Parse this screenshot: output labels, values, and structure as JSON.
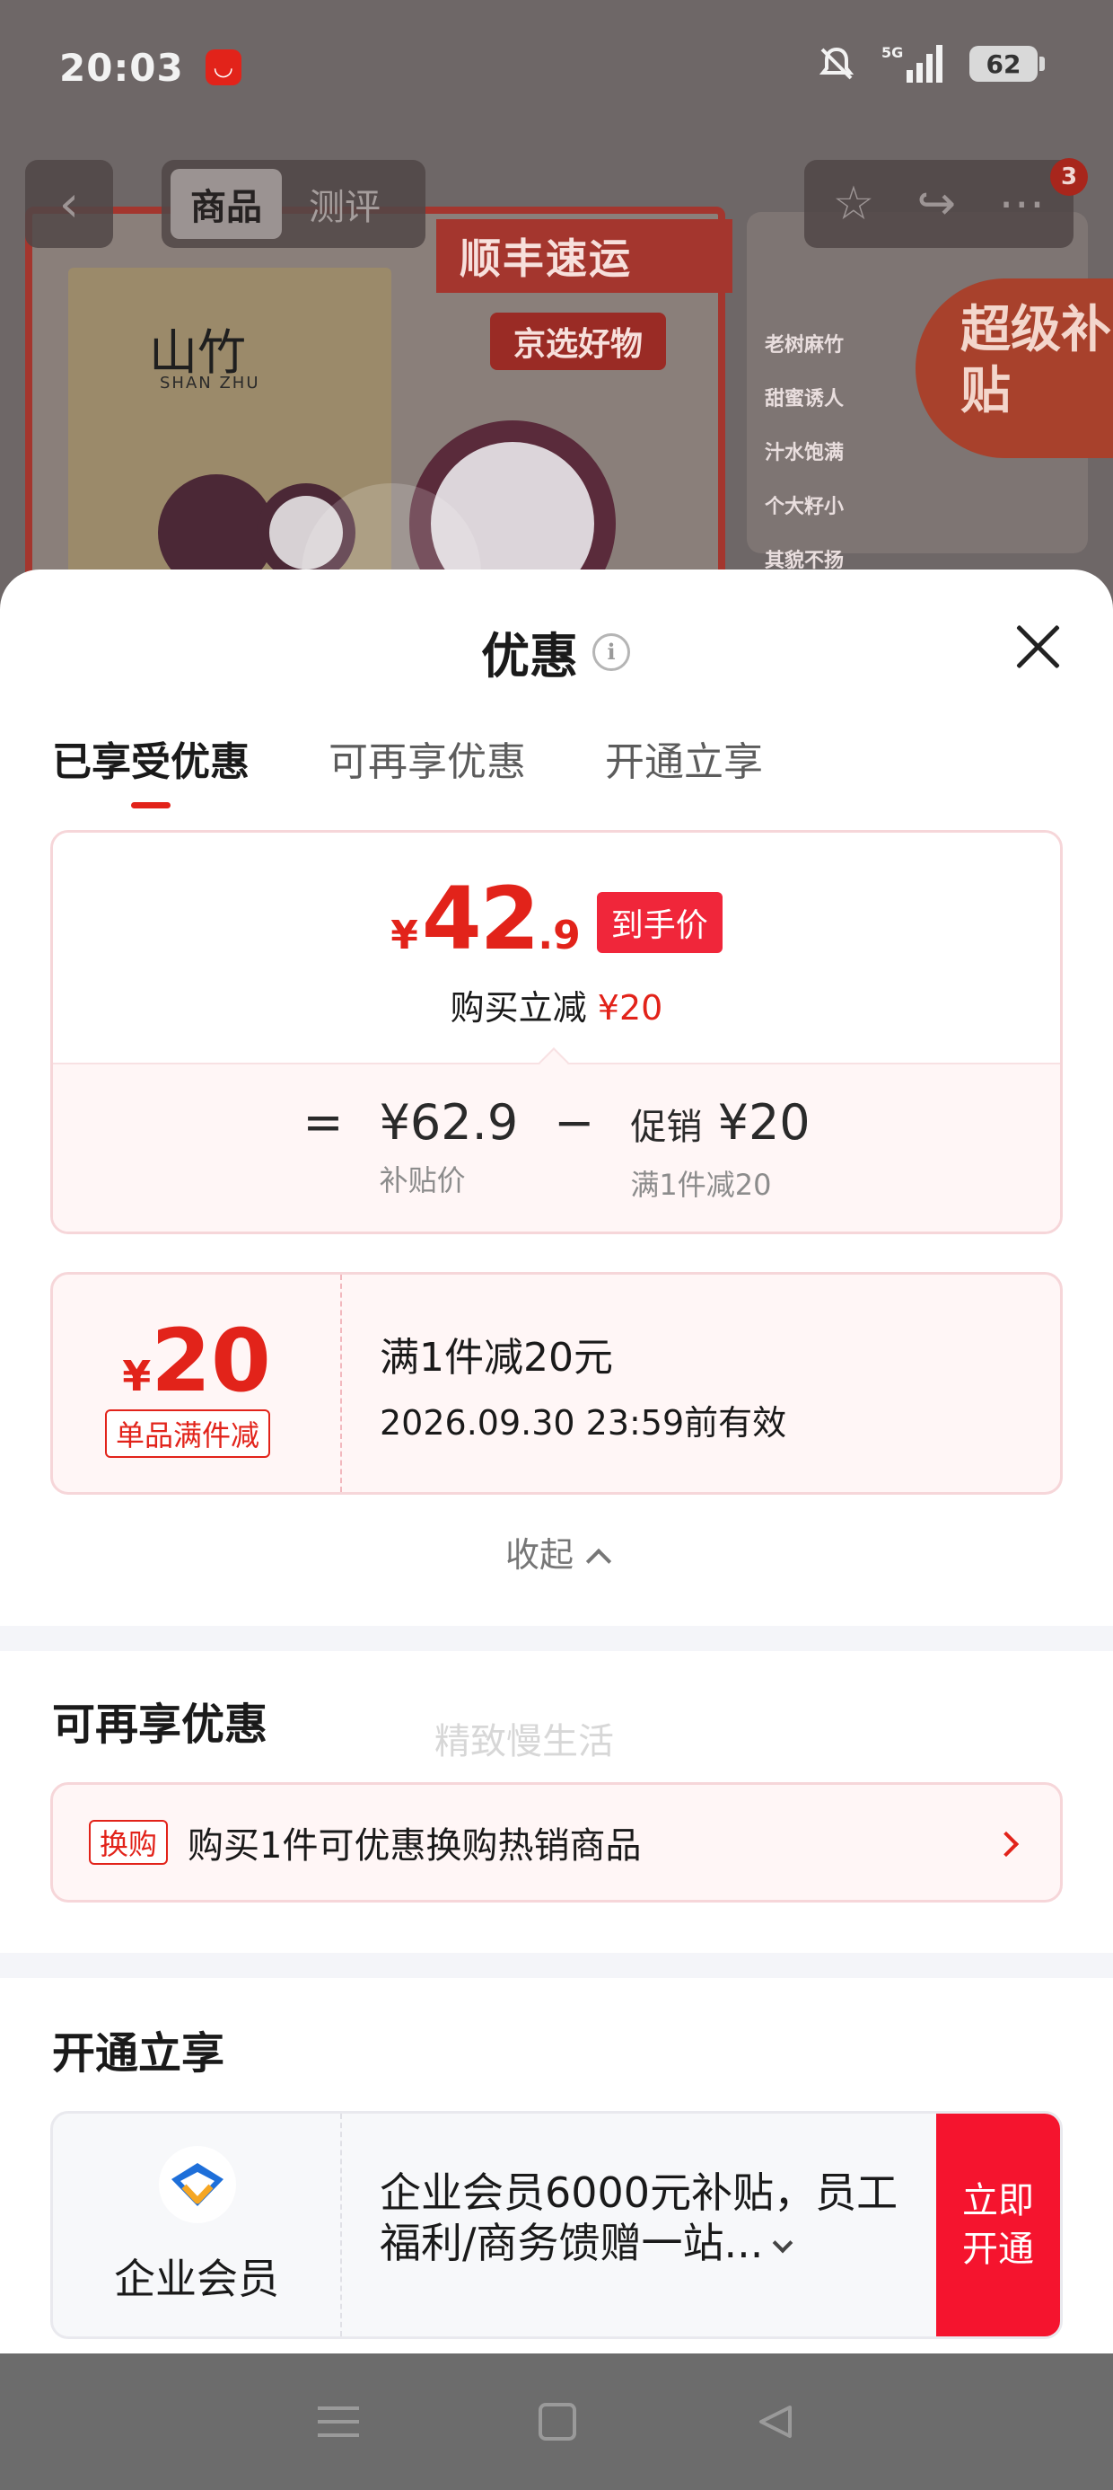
{
  "status_bar": {
    "time": "20:03",
    "app_badge": "◡",
    "network": "5G",
    "battery": "62"
  },
  "background_page": {
    "nav_tabs": [
      "商品",
      "测评"
    ],
    "notification_count": "3",
    "hero_badges": [
      "顺丰速运",
      "京选好物"
    ],
    "product_box_title": "山竹",
    "product_box_sub": "SHAN ZHU",
    "side_list": [
      "老树麻竹",
      "甜蜜诱人",
      "汁水饱满",
      "个大籽小",
      "其貌不扬"
    ],
    "super_subsidy": "超级补贴"
  },
  "sheet": {
    "title": "优惠",
    "tabs": [
      "已享受优惠",
      "可再享优惠",
      "开通立享"
    ],
    "price_card": {
      "currency": "¥",
      "price_int": "42",
      "price_dec": ".9",
      "price_tag": "到手价",
      "sub_prefix": "购买立减",
      "sub_amount": "¥20",
      "formula": {
        "equals": "=",
        "base_value": "¥62.9",
        "base_label": "补贴价",
        "minus": "−",
        "promo_name": "促销",
        "promo_value": "¥20",
        "promo_label": "满1件减20"
      }
    },
    "watermark": "精致慢生活",
    "coupon": {
      "currency": "¥",
      "amount": "20",
      "badge": "单品满件减",
      "title": "满1件减20元",
      "validity": "2026.09.30 23:59前有效"
    },
    "collapse_label": "收起",
    "more_section": {
      "title": "可再享优惠",
      "tag": "换购",
      "text": "购买1件可优惠换购热销商品"
    },
    "open_section": {
      "title": "开通立享",
      "member_label": "企业会员",
      "description": "企业会员6000元补贴，员工福利/商务馈赠一站...",
      "button_line1": "立即",
      "button_line2": "开通"
    }
  },
  "colors": {
    "accent_red": "#e2231a",
    "tag_red": "#f0263a",
    "card_border": "#f6d6d9",
    "card_bg": "#fff6f6"
  }
}
